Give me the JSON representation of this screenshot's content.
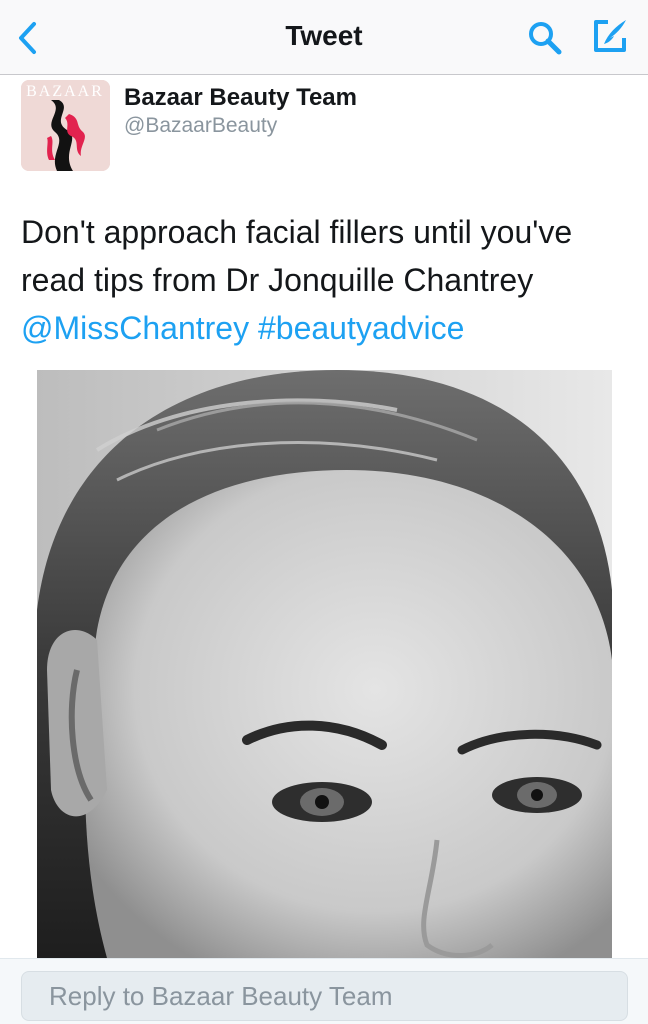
{
  "nav": {
    "title": "Tweet",
    "icons": {
      "back": "chevron-left-icon",
      "search": "search-icon",
      "compose": "compose-icon"
    },
    "accent": "#1da1f2"
  },
  "tweet": {
    "author": {
      "name": "Bazaar Beauty Team",
      "handle": "@BazaarBeauty",
      "avatar_logo_text": "BAZAAR"
    },
    "text_lines": [
      "Don't approach facial fillers until you've",
      "read tips from Dr Jonquille Chantrey"
    ],
    "mention": "@MissChantrey",
    "hashtag": "#beautyadvice",
    "photo": {
      "description_icon": "portrait-photo",
      "style": "black-and-white"
    }
  },
  "reply": {
    "placeholder": "Reply to Bazaar Beauty Team"
  }
}
